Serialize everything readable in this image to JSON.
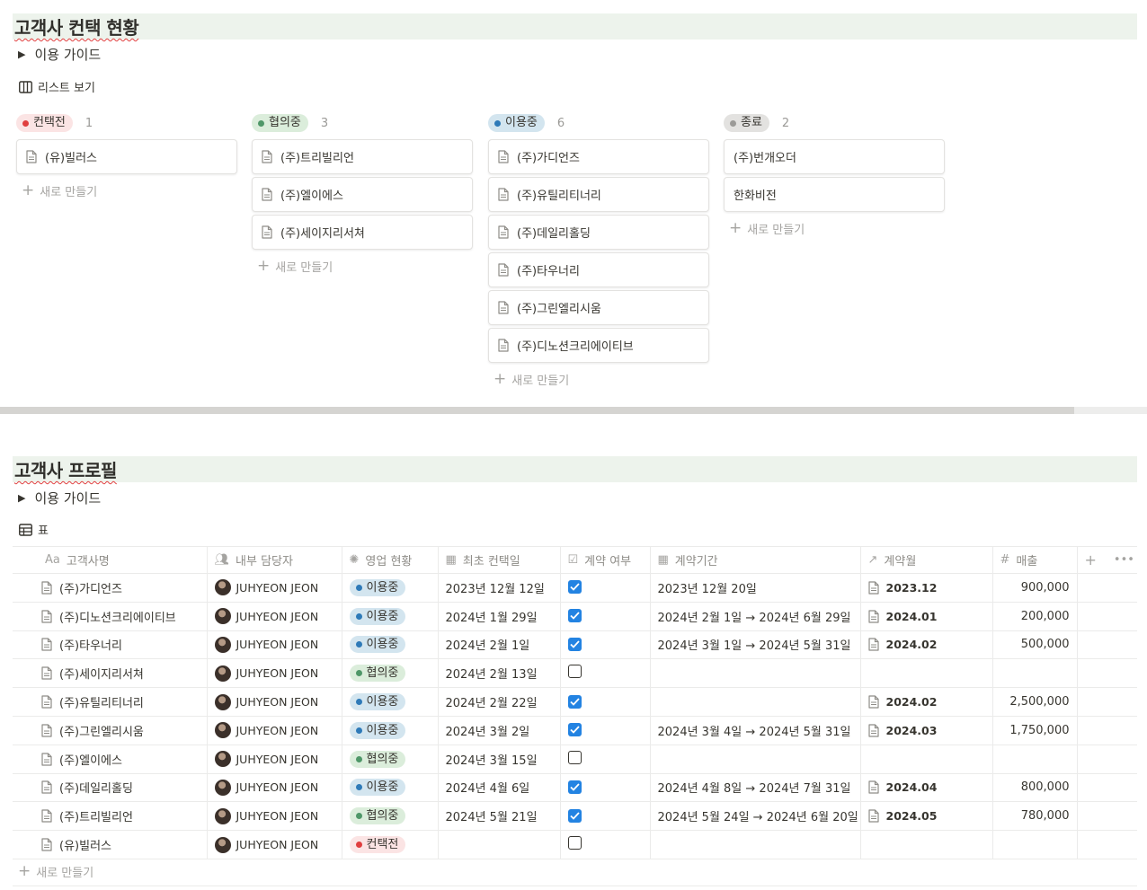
{
  "section1": {
    "title": "고객사 컨택 현황",
    "guide": "이용 가이드",
    "view": "리스트 보기",
    "new_label": "새로 만들기",
    "columns": [
      {
        "status": "컨택전",
        "count": "1",
        "bg": "#fbe4e4",
        "dot": "#e03e3e",
        "cards": [
          "(유)빌러스"
        ]
      },
      {
        "status": "협의중",
        "count": "3",
        "bg": "#dbeddb",
        "dot": "#4f9768",
        "cards": [
          "(주)트리빌리언",
          "(주)엘이에스",
          "(주)세이지리서쳐"
        ]
      },
      {
        "status": "이용중",
        "count": "6",
        "bg": "#d3e5ef",
        "dot": "#2e7ab8",
        "cards": [
          "(주)가디언즈",
          "(주)유틸리티너리",
          "(주)데일리홀딩",
          "(주)타우너리",
          "(주)그린엘리시움",
          "(주)디노션크리에이티브"
        ]
      },
      {
        "status": "종료",
        "count": "2",
        "bg": "#e3e2e0",
        "dot": "#9b9a97",
        "cards": [
          "(주)번개오더",
          "한화비전"
        ]
      }
    ]
  },
  "section2": {
    "title": "고객사 프로필",
    "guide": "이용 가이드",
    "view": "표",
    "new_label": "새로 만들기",
    "headers": [
      "고객사명",
      "내부 담당자",
      "영업 현황",
      "최초 컨택일",
      "계약 여부",
      "계약기간",
      "계약월",
      "매출"
    ],
    "header_icons": [
      "Aa",
      "people-icon",
      "status-icon",
      "calendar-icon",
      "checkbox-icon",
      "calendar-icon",
      "relation-arrow-icon",
      "#"
    ],
    "rows": [
      {
        "name": "(주)가디언즈",
        "owner": "JUHYEON JEON",
        "status": "이용중",
        "first": "2023년 12월 12일",
        "contract": true,
        "period": "2023년 12월 20일",
        "month": "2023.12",
        "revenue": "900,000"
      },
      {
        "name": "(주)디노션크리에이티브",
        "owner": "JUHYEON JEON",
        "status": "이용중",
        "first": "2024년 1월 29일",
        "contract": true,
        "period": "2024년 2월 1일 → 2024년 6월 29일",
        "month": "2024.01",
        "revenue": "200,000"
      },
      {
        "name": "(주)타우너리",
        "owner": "JUHYEON JEON",
        "status": "이용중",
        "first": "2024년 2월 1일",
        "contract": true,
        "period": "2024년 3월 1일 → 2024년 5월 31일",
        "month": "2024.02",
        "revenue": "500,000"
      },
      {
        "name": "(주)세이지리서쳐",
        "owner": "JUHYEON JEON",
        "status": "협의중",
        "first": "2024년 2월 13일",
        "contract": false,
        "period": "",
        "month": "",
        "revenue": ""
      },
      {
        "name": "(주)유틸리티너리",
        "owner": "JUHYEON JEON",
        "status": "이용중",
        "first": "2024년 2월 22일",
        "contract": true,
        "period": "",
        "month": "2024.02",
        "revenue": "2,500,000"
      },
      {
        "name": "(주)그린엘리시움",
        "owner": "JUHYEON JEON",
        "status": "이용중",
        "first": "2024년 3월 2일",
        "contract": true,
        "period": "2024년 3월 4일 → 2024년 5월 31일",
        "month": "2024.03",
        "revenue": "1,750,000"
      },
      {
        "name": "(주)엘이에스",
        "owner": "JUHYEON JEON",
        "status": "협의중",
        "first": "2024년 3월 15일",
        "contract": false,
        "period": "",
        "month": "",
        "revenue": ""
      },
      {
        "name": "(주)데일리홀딩",
        "owner": "JUHYEON JEON",
        "status": "이용중",
        "first": "2024년 4월 6일",
        "contract": true,
        "period": "2024년 4월 8일 → 2024년 7월 31일",
        "month": "2024.04",
        "revenue": "800,000"
      },
      {
        "name": "(주)트리빌리언",
        "owner": "JUHYEON JEON",
        "status": "협의중",
        "first": "2024년 5월 21일",
        "contract": true,
        "period": "2024년 5월 24일 → 2024년 6월 20일",
        "month": "2024.05",
        "revenue": "780,000"
      },
      {
        "name": "(유)빌러스",
        "owner": "JUHYEON JEON",
        "status": "컨택전",
        "first": "",
        "contract": false,
        "period": "",
        "month": "",
        "revenue": ""
      }
    ],
    "status_colors": {
      "이용중": {
        "bg": "#d3e5ef",
        "dot": "#2e7ab8"
      },
      "협의중": {
        "bg": "#dbeddb",
        "dot": "#4f9768"
      },
      "컨택전": {
        "bg": "#fbe4e4",
        "dot": "#e03e3e"
      }
    }
  }
}
